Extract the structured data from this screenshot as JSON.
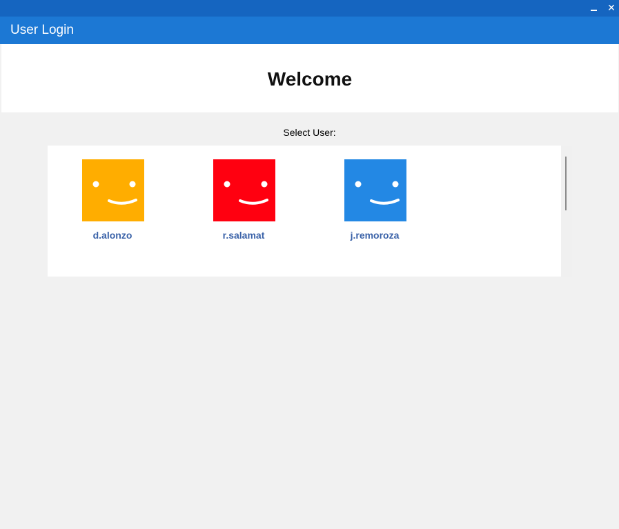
{
  "window": {
    "minimize_label": "–",
    "close_label": "✕"
  },
  "app": {
    "title": "User Login"
  },
  "welcome": {
    "heading": "Welcome"
  },
  "select_label": "Select User:",
  "users": [
    {
      "name": "d.alonzo",
      "color": "#ffad00",
      "icon": "smiley-face-icon"
    },
    {
      "name": "r.salamat",
      "color": "#ff0010",
      "icon": "smiley-face-icon"
    },
    {
      "name": "j.remoroza",
      "color": "#2388e4",
      "icon": "smiley-face-icon"
    }
  ]
}
